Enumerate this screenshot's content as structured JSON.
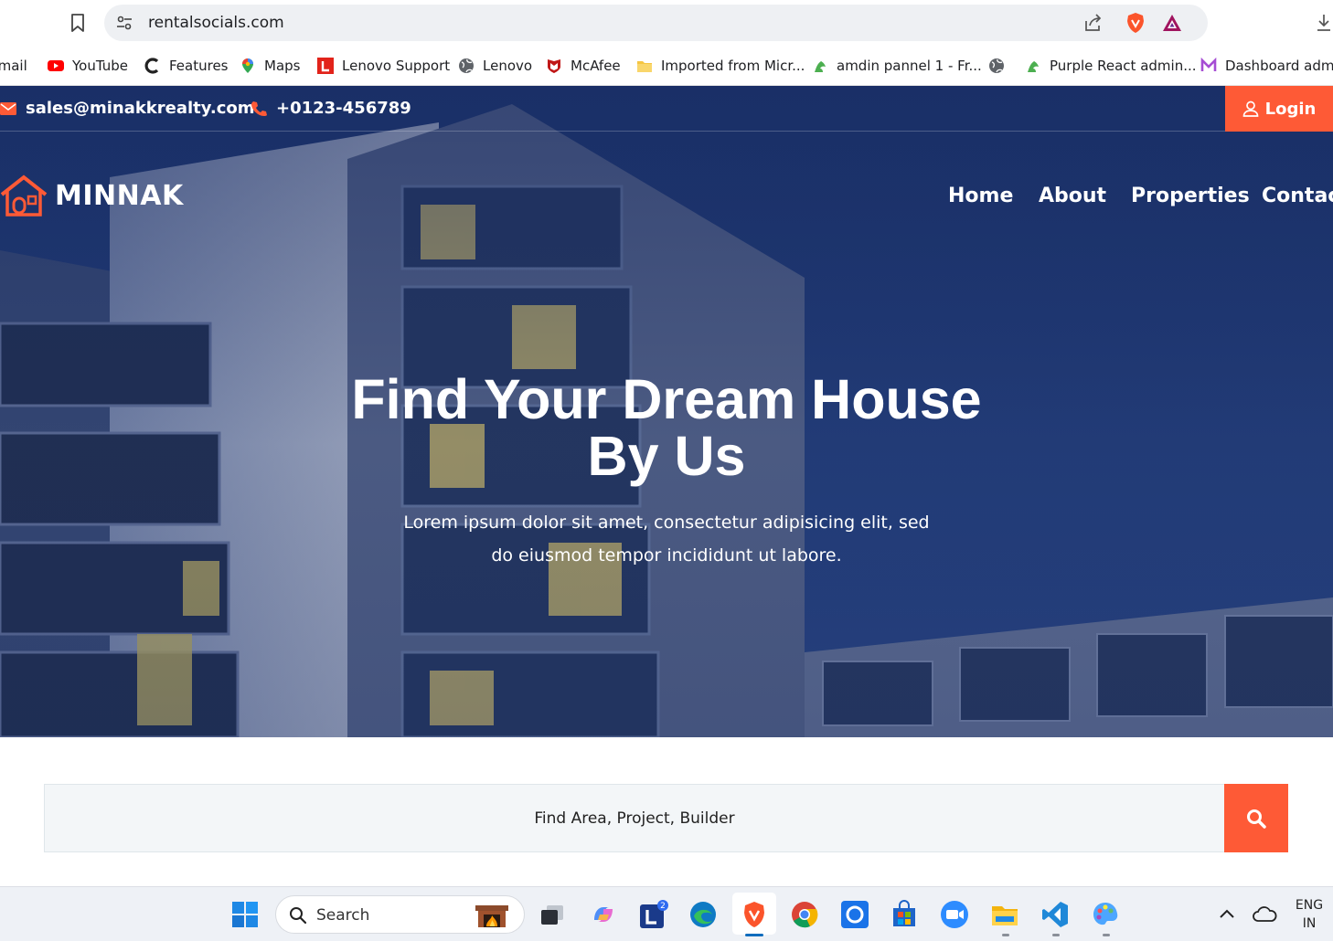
{
  "browser": {
    "url": "rentalsocials.com",
    "bookmarks": [
      {
        "label": "Gmail",
        "icon": "gmail-icon"
      },
      {
        "label": "YouTube",
        "icon": "youtube-icon"
      },
      {
        "label": "Features",
        "icon": "c-logo-icon"
      },
      {
        "label": "Maps",
        "icon": "maps-pin-icon"
      },
      {
        "label": "Lenovo Support",
        "icon": "lenovo-l-icon"
      },
      {
        "label": "Lenovo",
        "icon": "globe-icon"
      },
      {
        "label": "McAfee",
        "icon": "mcafee-shield-icon"
      },
      {
        "label": "Imported from Micr...",
        "icon": "folder-icon"
      },
      {
        "label": "amdin pannel 1 - Fr...",
        "icon": "green-figure-icon"
      },
      {
        "label": "",
        "icon": "globe-icon"
      },
      {
        "label": "Purple React admin...",
        "icon": "green-figure-icon"
      },
      {
        "label": "Dashboard admin",
        "icon": "m-logo-icon"
      }
    ]
  },
  "site": {
    "email": "sales@minakkrealty.com",
    "phone": "+0123-456789",
    "login_label": "Login",
    "logo_text": "MINNAK",
    "nav": [
      "Home",
      "About",
      "Properties",
      "Contact"
    ],
    "hero_title": "Find Your Dream House By Us",
    "hero_subtitle": "Lorem ipsum dolor sit amet, consectetur adipisicing elit, sed do eiusmod tempor incididunt ut labore.",
    "search_placeholder": "Find Area, Project, Builder",
    "accent_color": "#fe5a36"
  },
  "taskbar": {
    "search_label": "Search",
    "lang_line1": "ENG",
    "lang_line2": "IN",
    "badge_count": "2"
  }
}
